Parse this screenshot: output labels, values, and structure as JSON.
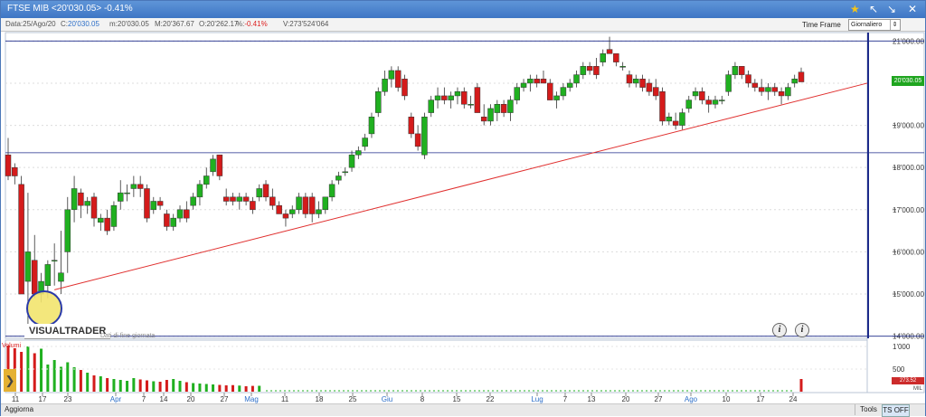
{
  "window": {
    "title": "FTSE MIB <20'030.05> -0.41%",
    "star_icon": "star-icon",
    "controls": [
      "↖",
      "↘",
      "✕"
    ]
  },
  "info_bar": {
    "data_label": "Data:",
    "data_value": "25/Ago/20",
    "c_label": "C:",
    "c_value": "20'030.05",
    "m_label": "m:",
    "m_value": "20'030.05",
    "M_label": "M:",
    "M_value": "20'367.67",
    "o_label": "O:",
    "o_value": "20'262.17",
    "pct_label": "%:",
    "pct_value": "-0.41%",
    "v_label": "V:",
    "v_value": "273'524'064"
  },
  "timeframe": {
    "label": "Time Frame",
    "value": "Giornaliero"
  },
  "price_axis": {
    "ticks": [
      "21'000.00",
      "19'000.00",
      "18'000.00",
      "17'000.00",
      "16'000.00",
      "15'000.00",
      "14'000.00"
    ],
    "last_price": "20'030.05"
  },
  "volume_axis": {
    "ticks": [
      "1'000",
      "500"
    ],
    "unit": "MIL",
    "last_volume": "273.52"
  },
  "branding": {
    "logo": "VISUALTRADER",
    "subtitle": "Dati di fine giornata"
  },
  "volume_label": "Volumi",
  "info_buttons": [
    "i",
    "i"
  ],
  "x_axis": {
    "labels": [
      "11",
      "17",
      "23",
      "Apr",
      "7",
      "14",
      "20",
      "27",
      "Mag",
      "11",
      "18",
      "25",
      "Giu",
      "8",
      "15",
      "22",
      "Lug",
      "7",
      "13",
      "20",
      "27",
      "Ago",
      "10",
      "17",
      "24"
    ],
    "month_labels": [
      "Apr",
      "Mag",
      "Giu",
      "Lug",
      "Ago"
    ]
  },
  "bottom_bar": {
    "refresh": "Aggiorna",
    "tools": "Tools",
    "ts": "TS OFF"
  },
  "colors": {
    "up": "#20b020",
    "down": "#d41b1b",
    "trend": "#e0302f",
    "hline": "#1c2a8a",
    "highlight": "#f2e46e"
  },
  "chart_data": {
    "type": "candlestick",
    "title": "FTSE MIB",
    "ylabel": "",
    "ylim": [
      13950,
      21200
    ],
    "horizontal_lines": [
      21000,
      18350,
      14000
    ],
    "trendline": {
      "from": [
        15100,
        "23 Mar"
      ],
      "to": [
        19994,
        "25 Ago"
      ]
    },
    "candles": [
      {
        "o": 18300,
        "h": 18700,
        "l": 17700,
        "c": 17800
      },
      {
        "o": 18000,
        "h": 18100,
        "l": 17600,
        "c": 17800
      },
      {
        "o": 17600,
        "h": 17800,
        "l": 15000,
        "c": 15000
      },
      {
        "o": 15300,
        "h": 17400,
        "l": 14200,
        "c": 16000
      },
      {
        "o": 15800,
        "h": 16400,
        "l": 14900,
        "c": 15000
      },
      {
        "o": 15000,
        "h": 15500,
        "l": 14800,
        "c": 15300
      },
      {
        "o": 15200,
        "h": 15800,
        "l": 14900,
        "c": 15700
      },
      {
        "o": 15800,
        "h": 16200,
        "l": 15200,
        "c": 15800
      },
      {
        "o": 15300,
        "h": 16500,
        "l": 15000,
        "c": 15500
      },
      {
        "o": 16000,
        "h": 17300,
        "l": 15500,
        "c": 17000
      },
      {
        "o": 17000,
        "h": 17800,
        "l": 16700,
        "c": 17500
      },
      {
        "o": 17400,
        "h": 17500,
        "l": 16800,
        "c": 17100
      },
      {
        "o": 17100,
        "h": 17300,
        "l": 16900,
        "c": 17200
      },
      {
        "o": 17300,
        "h": 17400,
        "l": 16600,
        "c": 16800
      },
      {
        "o": 16700,
        "h": 16900,
        "l": 16500,
        "c": 16800
      },
      {
        "o": 16800,
        "h": 17000,
        "l": 16400,
        "c": 16500
      },
      {
        "o": 16600,
        "h": 17200,
        "l": 16500,
        "c": 17100
      },
      {
        "o": 17200,
        "h": 17700,
        "l": 17000,
        "c": 17400
      },
      {
        "o": 17400,
        "h": 17600,
        "l": 17200,
        "c": 17400
      },
      {
        "o": 17500,
        "h": 17800,
        "l": 17300,
        "c": 17600
      },
      {
        "o": 17600,
        "h": 17800,
        "l": 17300,
        "c": 17500
      },
      {
        "o": 17500,
        "h": 17600,
        "l": 16700,
        "c": 16800
      },
      {
        "o": 17000,
        "h": 17300,
        "l": 16900,
        "c": 17200
      },
      {
        "o": 17200,
        "h": 17300,
        "l": 17000,
        "c": 17100
      },
      {
        "o": 16900,
        "h": 17000,
        "l": 16500,
        "c": 16600
      },
      {
        "o": 16600,
        "h": 16900,
        "l": 16500,
        "c": 16800
      },
      {
        "o": 16800,
        "h": 17100,
        "l": 16700,
        "c": 17000
      },
      {
        "o": 17000,
        "h": 17200,
        "l": 16700,
        "c": 16800
      },
      {
        "o": 17100,
        "h": 17400,
        "l": 17000,
        "c": 17300
      },
      {
        "o": 17300,
        "h": 17700,
        "l": 17100,
        "c": 17600
      },
      {
        "o": 17600,
        "h": 18000,
        "l": 17500,
        "c": 17800
      },
      {
        "o": 17900,
        "h": 18300,
        "l": 17800,
        "c": 18200
      },
      {
        "o": 18300,
        "h": 18300,
        "l": 17700,
        "c": 17800
      },
      {
        "o": 17300,
        "h": 17500,
        "l": 17100,
        "c": 17200
      },
      {
        "o": 17300,
        "h": 17400,
        "l": 17100,
        "c": 17200
      },
      {
        "o": 17200,
        "h": 17400,
        "l": 17000,
        "c": 17300
      },
      {
        "o": 17300,
        "h": 17400,
        "l": 17100,
        "c": 17200
      },
      {
        "o": 17200,
        "h": 17300,
        "l": 16900,
        "c": 17000
      },
      {
        "o": 17300,
        "h": 17600,
        "l": 17200,
        "c": 17500
      },
      {
        "o": 17600,
        "h": 17700,
        "l": 17200,
        "c": 17300
      },
      {
        "o": 17300,
        "h": 17500,
        "l": 17000,
        "c": 17100
      },
      {
        "o": 17100,
        "h": 17200,
        "l": 16900,
        "c": 16900
      },
      {
        "o": 16900,
        "h": 17000,
        "l": 16600,
        "c": 16800
      },
      {
        "o": 16900,
        "h": 17100,
        "l": 16800,
        "c": 17000
      },
      {
        "o": 17000,
        "h": 17400,
        "l": 16900,
        "c": 17300
      },
      {
        "o": 17300,
        "h": 17400,
        "l": 16800,
        "c": 16900
      },
      {
        "o": 17300,
        "h": 17400,
        "l": 16700,
        "c": 16900
      },
      {
        "o": 16900,
        "h": 17200,
        "l": 16800,
        "c": 17000
      },
      {
        "o": 17000,
        "h": 17300,
        "l": 16900,
        "c": 17300
      },
      {
        "o": 17300,
        "h": 17700,
        "l": 17200,
        "c": 17600
      },
      {
        "o": 17700,
        "h": 17900,
        "l": 17600,
        "c": 17800
      },
      {
        "o": 17900,
        "h": 18000,
        "l": 17800,
        "c": 17900
      },
      {
        "o": 18000,
        "h": 18400,
        "l": 17900,
        "c": 18300
      },
      {
        "o": 18300,
        "h": 18500,
        "l": 18200,
        "c": 18400
      },
      {
        "o": 18500,
        "h": 18800,
        "l": 18400,
        "c": 18700
      },
      {
        "o": 18800,
        "h": 19300,
        "l": 18700,
        "c": 19200
      },
      {
        "o": 19300,
        "h": 19900,
        "l": 19200,
        "c": 19800
      },
      {
        "o": 19800,
        "h": 20300,
        "l": 19700,
        "c": 20100
      },
      {
        "o": 20100,
        "h": 20400,
        "l": 19900,
        "c": 20300
      },
      {
        "o": 20300,
        "h": 20400,
        "l": 19800,
        "c": 19900
      },
      {
        "o": 20100,
        "h": 20200,
        "l": 19600,
        "c": 19700
      },
      {
        "o": 19200,
        "h": 19300,
        "l": 18700,
        "c": 18800
      },
      {
        "o": 18800,
        "h": 19000,
        "l": 18400,
        "c": 18500
      },
      {
        "o": 18300,
        "h": 19300,
        "l": 18200,
        "c": 19200
      },
      {
        "o": 19300,
        "h": 19700,
        "l": 19200,
        "c": 19600
      },
      {
        "o": 19600,
        "h": 19900,
        "l": 19400,
        "c": 19700
      },
      {
        "o": 19700,
        "h": 19900,
        "l": 19500,
        "c": 19600
      },
      {
        "o": 19600,
        "h": 19800,
        "l": 19400,
        "c": 19700
      },
      {
        "o": 19700,
        "h": 19900,
        "l": 19500,
        "c": 19800
      },
      {
        "o": 19800,
        "h": 19900,
        "l": 19400,
        "c": 19500
      },
      {
        "o": 19500,
        "h": 19700,
        "l": 19400,
        "c": 19500
      },
      {
        "o": 19900,
        "h": 20000,
        "l": 19300,
        "c": 19300
      },
      {
        "o": 19200,
        "h": 19500,
        "l": 19000,
        "c": 19100
      },
      {
        "o": 19100,
        "h": 19500,
        "l": 19000,
        "c": 19400
      },
      {
        "o": 19300,
        "h": 19600,
        "l": 19100,
        "c": 19500
      },
      {
        "o": 19500,
        "h": 19600,
        "l": 19200,
        "c": 19300
      },
      {
        "o": 19300,
        "h": 19700,
        "l": 19100,
        "c": 19600
      },
      {
        "o": 19600,
        "h": 20000,
        "l": 19500,
        "c": 19900
      },
      {
        "o": 19900,
        "h": 20100,
        "l": 19800,
        "c": 20000
      },
      {
        "o": 20000,
        "h": 20200,
        "l": 19800,
        "c": 20100
      },
      {
        "o": 20100,
        "h": 20200,
        "l": 19900,
        "c": 20000
      },
      {
        "o": 20100,
        "h": 20300,
        "l": 20000,
        "c": 20000
      },
      {
        "o": 20000,
        "h": 20100,
        "l": 19600,
        "c": 19600
      },
      {
        "o": 19600,
        "h": 19800,
        "l": 19400,
        "c": 19700
      },
      {
        "o": 19700,
        "h": 20000,
        "l": 19600,
        "c": 19900
      },
      {
        "o": 19900,
        "h": 20100,
        "l": 19800,
        "c": 20000
      },
      {
        "o": 20000,
        "h": 20300,
        "l": 19900,
        "c": 20200
      },
      {
        "o": 20200,
        "h": 20500,
        "l": 20100,
        "c": 20400
      },
      {
        "o": 20400,
        "h": 20500,
        "l": 20200,
        "c": 20300
      },
      {
        "o": 20400,
        "h": 20600,
        "l": 20100,
        "c": 20200
      },
      {
        "o": 20500,
        "h": 20800,
        "l": 20400,
        "c": 20700
      },
      {
        "o": 20800,
        "h": 21100,
        "l": 20700,
        "c": 20700
      },
      {
        "o": 20700,
        "h": 20700,
        "l": 20400,
        "c": 20500
      },
      {
        "o": 20400,
        "h": 20500,
        "l": 20300,
        "c": 20400
      },
      {
        "o": 20200,
        "h": 20300,
        "l": 19900,
        "c": 20000
      },
      {
        "o": 20000,
        "h": 20200,
        "l": 19900,
        "c": 20100
      },
      {
        "o": 20100,
        "h": 20200,
        "l": 19800,
        "c": 19900
      },
      {
        "o": 20000,
        "h": 20100,
        "l": 19700,
        "c": 19800
      },
      {
        "o": 19900,
        "h": 20100,
        "l": 19600,
        "c": 19700
      },
      {
        "o": 19800,
        "h": 19900,
        "l": 19000,
        "c": 19100
      },
      {
        "o": 19100,
        "h": 19300,
        "l": 19000,
        "c": 19200
      },
      {
        "o": 19100,
        "h": 19300,
        "l": 18900,
        "c": 19000
      },
      {
        "o": 19000,
        "h": 19400,
        "l": 18900,
        "c": 19300
      },
      {
        "o": 19400,
        "h": 19700,
        "l": 19300,
        "c": 19600
      },
      {
        "o": 19700,
        "h": 19900,
        "l": 19600,
        "c": 19800
      },
      {
        "o": 19800,
        "h": 19900,
        "l": 19500,
        "c": 19600
      },
      {
        "o": 19600,
        "h": 19700,
        "l": 19300,
        "c": 19500
      },
      {
        "o": 19500,
        "h": 19700,
        "l": 19400,
        "c": 19600
      },
      {
        "o": 19600,
        "h": 19700,
        "l": 19500,
        "c": 19600
      },
      {
        "o": 19800,
        "h": 20300,
        "l": 19700,
        "c": 20200
      },
      {
        "o": 20200,
        "h": 20500,
        "l": 20100,
        "c": 20400
      },
      {
        "o": 20400,
        "h": 20400,
        "l": 20100,
        "c": 20200
      },
      {
        "o": 20200,
        "h": 20300,
        "l": 19900,
        "c": 20000
      },
      {
        "o": 20000,
        "h": 20100,
        "l": 19800,
        "c": 19900
      },
      {
        "o": 19900,
        "h": 20100,
        "l": 19700,
        "c": 19800
      },
      {
        "o": 19800,
        "h": 20000,
        "l": 19600,
        "c": 19900
      },
      {
        "o": 19900,
        "h": 20000,
        "l": 19700,
        "c": 19800
      },
      {
        "o": 19800,
        "h": 19900,
        "l": 19500,
        "c": 19700
      },
      {
        "o": 19700,
        "h": 20000,
        "l": 19600,
        "c": 19900
      },
      {
        "o": 20000,
        "h": 20200,
        "l": 19900,
        "c": 20100
      },
      {
        "o": 20262.17,
        "h": 20367.67,
        "l": 20030.05,
        "c": 20030.05
      }
    ],
    "volume": [
      1020,
      960,
      880,
      1000,
      850,
      950,
      600,
      700,
      550,
      650,
      540,
      480,
      420,
      360,
      340,
      300,
      280,
      260,
      240,
      300,
      270,
      250,
      230,
      220,
      260,
      280,
      240,
      210,
      190,
      180,
      170,
      160,
      150,
      140,
      145,
      135,
      120,
      128,
      130
    ]
  }
}
